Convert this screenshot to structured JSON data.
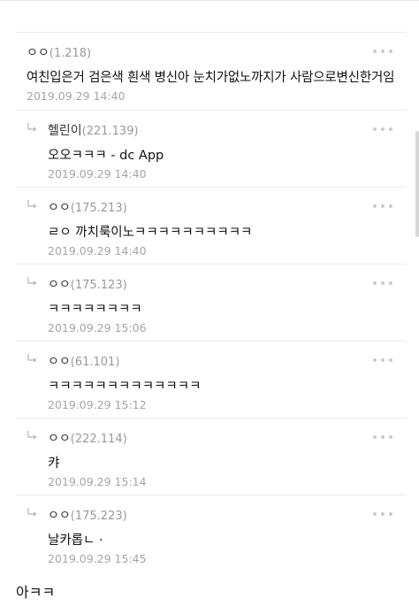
{
  "comments": [
    {
      "author": "ㅇㅇ",
      "ip": "(1.218)",
      "text": "여친입은거 검은색 흰색 병신아 눈치가없노까지가 사람으로변신한거임",
      "date": "2019.09.29 14:40"
    }
  ],
  "replies": [
    {
      "author": "헬린이",
      "ip": "(221.139)",
      "text": "오오ㅋㅋㅋ - dc App",
      "date": "2019.09.29 14:40"
    },
    {
      "author": "ㅇㅇ",
      "ip": "(175.213)",
      "text": "ㄹㅇ 까치룩이노ㅋㅋㅋㅋㅋㅋㅋㅋㅋㅋ",
      "date": "2019.09.29 14:40"
    },
    {
      "author": "ㅇㅇ",
      "ip": "(175.123)",
      "text": "ㅋㅋㅋㅋㅋㅋㅋㅋ",
      "date": "2019.09.29 15:06"
    },
    {
      "author": "ㅇㅇ",
      "ip": "(61.101)",
      "text": "ㅋㅋㅋㅋㅋㅋㅋㅋㅋㅋㅋㅋㅋ",
      "date": "2019.09.29 15:12"
    },
    {
      "author": "ㅇㅇ",
      "ip": "(222.114)",
      "text": "캬",
      "date": "2019.09.29 15:14"
    },
    {
      "author": "ㅇㅇ",
      "ip": "(175.223)",
      "text": "날카롭ㄴ ·",
      "date": "2019.09.29 15:45"
    }
  ],
  "footer": {
    "partial_text": "아ㅋㅋ"
  },
  "icons": {
    "reply": "reply-arrow-icon",
    "more": "more-dots-icon"
  },
  "colors": {
    "divider": "#ececec",
    "date": "#a5a5a5",
    "ip": "#999999",
    "text": "#111111"
  }
}
